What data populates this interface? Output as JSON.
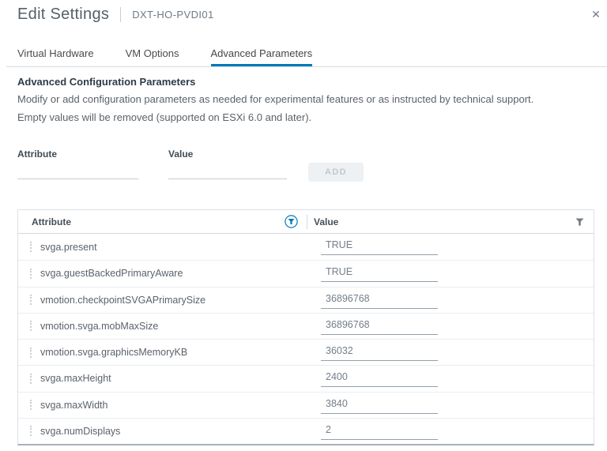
{
  "dialog": {
    "title": "Edit Settings",
    "vm_name": "DXT-HO-PVDI01",
    "close_icon": "✕"
  },
  "tabs": [
    {
      "label": "Virtual Hardware",
      "active": false
    },
    {
      "label": "VM Options",
      "active": false
    },
    {
      "label": "Advanced Parameters",
      "active": true
    }
  ],
  "section": {
    "heading": "Advanced Configuration Parameters",
    "description_line1": "Modify or add configuration parameters as needed for experimental features or as instructed by technical support.",
    "description_line2": "Empty values will be removed (supported on ESXi 6.0 and later)."
  },
  "add_form": {
    "attribute_label": "Attribute",
    "value_label": "Value",
    "attribute_value": "",
    "value_value": "",
    "add_button_label": "ADD",
    "add_button_enabled": false
  },
  "table": {
    "columns": [
      {
        "label": "Attribute",
        "filter_icon": "funnel-circled"
      },
      {
        "label": "Value",
        "filter_icon": "funnel"
      }
    ],
    "rows": [
      {
        "attribute": "svga.present",
        "value": "TRUE"
      },
      {
        "attribute": "svga.guestBackedPrimaryAware",
        "value": "TRUE"
      },
      {
        "attribute": "vmotion.checkpointSVGAPrimarySize",
        "value": "36896768"
      },
      {
        "attribute": "vmotion.svga.mobMaxSize",
        "value": "36896768"
      },
      {
        "attribute": "vmotion.svga.graphicsMemoryKB",
        "value": "36032"
      },
      {
        "attribute": "svga.maxHeight",
        "value": "2400"
      },
      {
        "attribute": "svga.maxWidth",
        "value": "3840"
      },
      {
        "attribute": "svga.numDisplays",
        "value": "2"
      }
    ]
  },
  "colors": {
    "accent_blue": "#0079b8",
    "title_text": "#55606b",
    "body_text": "#5b6269",
    "table_border": "#dde1e6",
    "table_bottom_border": "#aab1b9",
    "input_underline": "#949fa9"
  }
}
